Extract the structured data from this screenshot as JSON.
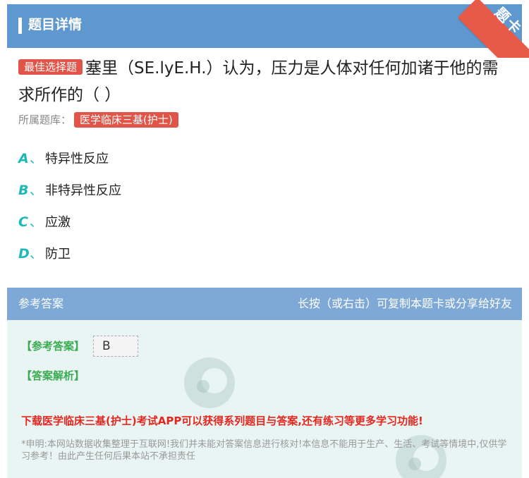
{
  "header": {
    "title": "题目详情"
  },
  "ribbon": {
    "label": "题卡",
    "color": "#e85a48"
  },
  "question": {
    "type_badge": "最佳选择题",
    "text": "塞里（SE.lyE.H.）认为，压力是人体对任何加诸于他的需求所作的（ ）",
    "bank_label": "所属题库：",
    "bank_name": "医学临床三基(护士)"
  },
  "options": [
    {
      "letter": "A",
      "sep": "、",
      "text": "特异性反应"
    },
    {
      "letter": "B",
      "sep": "、",
      "text": "非特异性反应"
    },
    {
      "letter": "C",
      "sep": "、",
      "text": "应激"
    },
    {
      "letter": "D",
      "sep": "、",
      "text": "防卫"
    }
  ],
  "answer_section": {
    "title": "参考答案",
    "hint": "长按（或右击）可复制本题卡或分享给好友",
    "ref_label": "【参考答案】",
    "ref_value": "B",
    "explain_label": "【答案解析】",
    "promo": "下载医学临床三基(护士)考试APP可以获得系列题目与答案,还有练习等更多学习功能!",
    "disclaimer": "*申明:本网站数据收集整理于互联网!我们并未能对答案信息进行核对!本信息不能用于生产、生活、考试等情境中,仅供学习参考！由此产生任何后果本站不承担责任"
  },
  "colors": {
    "header_blue": "#5f97cf",
    "answer_header_blue": "#7ea9d6",
    "badge_red": "#e05548",
    "option_teal": "#1db8b8",
    "label_green": "#3aab52",
    "promo_red": "#e5261f"
  }
}
